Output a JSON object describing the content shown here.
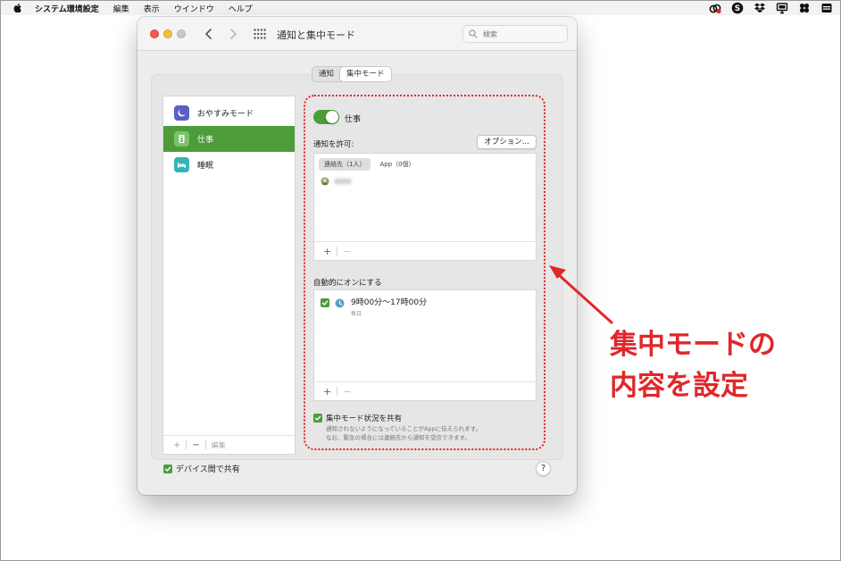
{
  "menubar": {
    "app_name": "システム環境設定",
    "menus": [
      "編集",
      "表示",
      "ウインドウ",
      "ヘルプ"
    ],
    "icons": [
      "creative-cloud-icon",
      "skype-icon",
      "dropbox-icon",
      "display-icon",
      "tencent-icon",
      "menu-extra-icon"
    ]
  },
  "window": {
    "title": "通知と集中モード",
    "search_placeholder": "検索",
    "tabs": [
      {
        "label": "通知",
        "active": false
      },
      {
        "label": "集中モード",
        "active": true
      }
    ]
  },
  "modes": [
    {
      "label": "おやすみモード",
      "icon": "moon-icon",
      "color": "#5b5fc7",
      "selected": false
    },
    {
      "label": "仕事",
      "icon": "id-badge-icon",
      "color": "#4d9c3c",
      "selected": true
    },
    {
      "label": "睡眠",
      "icon": "bed-icon",
      "color": "#33b5b5",
      "selected": false
    }
  ],
  "list_footer": {
    "add": "+",
    "remove": "−",
    "edit": "編集"
  },
  "device_share": {
    "label": "デバイス間で共有",
    "checked": true
  },
  "help": "?",
  "detail": {
    "focus_name": "仕事",
    "toggle_on": true,
    "allow_label": "通知を許可:",
    "options_button": "オプション...",
    "allow_tabs": [
      "連絡先（1人）",
      "App（0個）"
    ],
    "box_add": "+",
    "box_remove": "−",
    "auto_label": "自動的にオンにする",
    "schedule": {
      "time": "9時00分〜17時00分",
      "days": "毎日",
      "checked": true
    },
    "share_status_label": "集中モード状況を共有",
    "share_note_line1": "通知されないようになっていることがAppに伝えられます。",
    "share_note_line2": "なお、緊急の場合には連絡先から通知を受信できます。"
  },
  "annotation": {
    "line1": "集中モードの",
    "line2": "内容を設定",
    "color": "#e0272a"
  },
  "colors": {
    "accent": "#4d9c3c",
    "highlight": "#e0272a"
  }
}
